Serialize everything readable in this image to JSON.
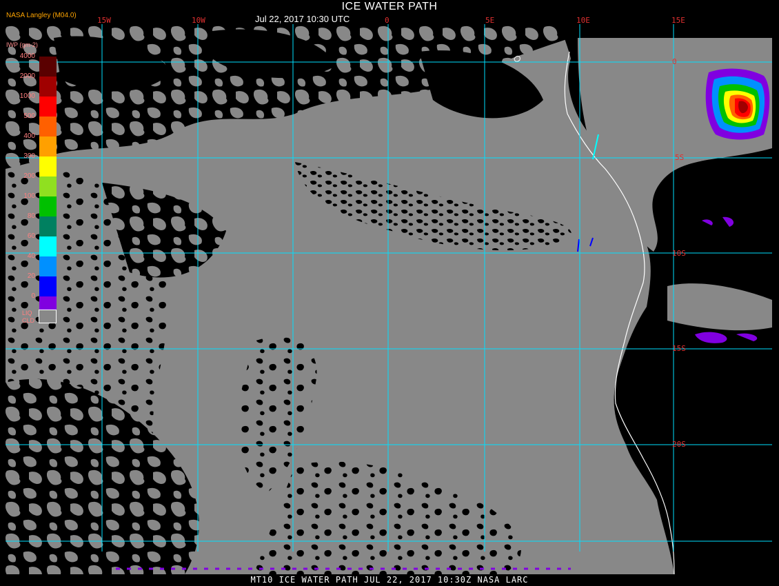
{
  "header": {
    "title": "ICE WATER PATH",
    "subtitle": "Jul 22, 2017 10:30 UTC",
    "provider": "NASA Langley (M04.0)"
  },
  "grid": {
    "longitudes": [
      "15W",
      "10W",
      "0",
      "5E",
      "10E",
      "15E"
    ],
    "latitudes": [
      "0",
      "5S",
      "10S",
      "15S",
      "20S"
    ]
  },
  "legend": {
    "title": "IWP (gm-2)",
    "ticks": [
      "4000",
      "2000",
      "1000",
      "500",
      "400",
      "300",
      "200",
      "100",
      "80",
      "60",
      "40",
      "20",
      "0"
    ],
    "colors": [
      "#5a0000",
      "#a00000",
      "#ff0000",
      "#ff6000",
      "#ffa000",
      "#ffff00",
      "#90e020",
      "#00c000",
      "#008060",
      "#00ffff",
      "#0090ff",
      "#0000ff",
      "#8000e0"
    ],
    "liq_label_1": "LIQ",
    "liq_label_2": "CLD",
    "liq_color": "#888888"
  },
  "colors": {
    "grid_line": "#00e0ff",
    "coastline": "#ffffff",
    "cloud_liquid": "#888888",
    "clear": "#000000",
    "label_red": "#e03030"
  },
  "footer": "MT10  ICE WATER PATH    JUL 22, 2017 10:30Z   NASA LARC"
}
